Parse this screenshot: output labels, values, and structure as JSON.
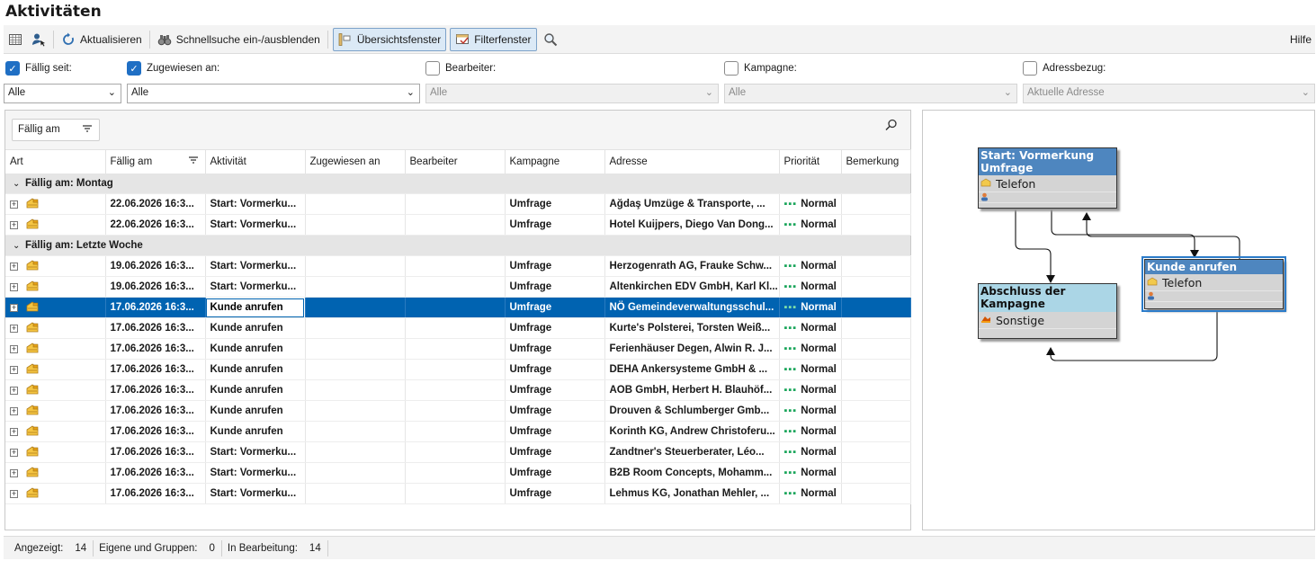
{
  "title": "Aktivitäten",
  "toolbar": {
    "refresh": "Aktualisieren",
    "quicksearch": "Schnellsuche ein-/ausblenden",
    "overview": "Übersichtsfenster",
    "filter": "Filterfenster",
    "help": "Hilfe"
  },
  "filters": [
    {
      "label": "Fällig seit:",
      "checked": true,
      "value": "Alle",
      "enabled": true
    },
    {
      "label": "Zugewiesen an:",
      "checked": true,
      "value": "Alle",
      "enabled": true
    },
    {
      "label": "Bearbeiter:",
      "checked": false,
      "value": "Alle",
      "enabled": false
    },
    {
      "label": "Kampagne:",
      "checked": false,
      "value": "Alle",
      "enabled": false
    },
    {
      "label": "Adressbezug:",
      "checked": false,
      "value": "Aktuelle Adresse",
      "enabled": false
    }
  ],
  "grid": {
    "group_chip": "Fällig am",
    "columns": [
      "Art",
      "Fällig am",
      "Aktivität",
      "Zugewiesen an",
      "Bearbeiter",
      "Kampagne",
      "Adresse",
      "Priorität",
      "Bemerkung"
    ],
    "groups": [
      {
        "label": "Fällig am: Montag",
        "rows": [
          {
            "due": "22.06.2026 16:3...",
            "activity": "Start: Vormerku...",
            "assigned": "",
            "editor": "",
            "campaign": "Umfrage",
            "address": "Ağdaş Umzüge & Transporte, ...",
            "priority": "Normal",
            "note": "",
            "selected": false
          },
          {
            "due": "22.06.2026 16:3...",
            "activity": "Start: Vormerku...",
            "assigned": "",
            "editor": "",
            "campaign": "Umfrage",
            "address": "Hotel Kuijpers, Diego Van Dong...",
            "priority": "Normal",
            "note": "",
            "selected": false
          }
        ]
      },
      {
        "label": "Fällig am: Letzte Woche",
        "rows": [
          {
            "due": "19.06.2026 16:3...",
            "activity": "Start: Vormerku...",
            "assigned": "",
            "editor": "",
            "campaign": "Umfrage",
            "address": "Herzogenrath AG, Frauke Schw...",
            "priority": "Normal",
            "note": "",
            "selected": false
          },
          {
            "due": "19.06.2026 16:3...",
            "activity": "Start: Vormerku...",
            "assigned": "",
            "editor": "",
            "campaign": "Umfrage",
            "address": "Altenkirchen EDV GmbH, Karl Kl...",
            "priority": "Normal",
            "note": "",
            "selected": false
          },
          {
            "due": "17.06.2026 16:3...",
            "activity": "Kunde anrufen",
            "assigned": "",
            "editor": "",
            "campaign": "Umfrage",
            "address": "NÖ Gemeindeverwaltungsschul...",
            "priority": "Normal",
            "note": "",
            "selected": true
          },
          {
            "due": "17.06.2026 16:3...",
            "activity": "Kunde anrufen",
            "assigned": "",
            "editor": "",
            "campaign": "Umfrage",
            "address": "Kurte's Polsterei, Torsten Weiß...",
            "priority": "Normal",
            "note": "",
            "selected": false
          },
          {
            "due": "17.06.2026 16:3...",
            "activity": "Kunde anrufen",
            "assigned": "",
            "editor": "",
            "campaign": "Umfrage",
            "address": "Ferienhäuser Degen, Alwin R. J...",
            "priority": "Normal",
            "note": "",
            "selected": false
          },
          {
            "due": "17.06.2026 16:3...",
            "activity": "Kunde anrufen",
            "assigned": "",
            "editor": "",
            "campaign": "Umfrage",
            "address": "DEHA Ankersysteme GmbH & ...",
            "priority": "Normal",
            "note": "",
            "selected": false
          },
          {
            "due": "17.06.2026 16:3...",
            "activity": "Kunde anrufen",
            "assigned": "",
            "editor": "",
            "campaign": "Umfrage",
            "address": "AOB GmbH, Herbert H. Blauhöf...",
            "priority": "Normal",
            "note": "",
            "selected": false
          },
          {
            "due": "17.06.2026 16:3...",
            "activity": "Kunde anrufen",
            "assigned": "",
            "editor": "",
            "campaign": "Umfrage",
            "address": "Drouven & Schlumberger Gmb...",
            "priority": "Normal",
            "note": "",
            "selected": false
          },
          {
            "due": "17.06.2026 16:3...",
            "activity": "Kunde anrufen",
            "assigned": "",
            "editor": "",
            "campaign": "Umfrage",
            "address": "Korinth KG, Andrew Christoferu...",
            "priority": "Normal",
            "note": "",
            "selected": false
          },
          {
            "due": "17.06.2026 16:3...",
            "activity": "Start: Vormerku...",
            "assigned": "",
            "editor": "",
            "campaign": "Umfrage",
            "address": "Zandtner's Steuerberater, Léo...",
            "priority": "Normal",
            "note": "",
            "selected": false
          },
          {
            "due": "17.06.2026 16:3...",
            "activity": "Start: Vormerku...",
            "assigned": "",
            "editor": "",
            "campaign": "Umfrage",
            "address": "B2B Room Concepts, Mohamm...",
            "priority": "Normal",
            "note": "",
            "selected": false
          },
          {
            "due": "17.06.2026 16:3...",
            "activity": "Start: Vormerku...",
            "assigned": "",
            "editor": "",
            "campaign": "Umfrage",
            "address": "Lehmus KG, Jonathan Mehler, ...",
            "priority": "Normal",
            "note": "",
            "selected": false
          }
        ]
      }
    ]
  },
  "diagram": {
    "nodes": [
      {
        "id": "start",
        "title": "Start: Vormerkung Umfrage",
        "type": "Telefon",
        "icon": "phone-icon",
        "style": "dark",
        "selected": false
      },
      {
        "id": "kunde",
        "title": "Kunde anrufen",
        "type": "Telefon",
        "icon": "phone-icon",
        "style": "dark",
        "selected": true
      },
      {
        "id": "abschluss",
        "title": "Abschluss der Kampagne",
        "type": "Sonstige",
        "icon": "misc-icon",
        "style": "light",
        "selected": false
      }
    ]
  },
  "status": {
    "shown_label": "Angezeigt:",
    "shown": "14",
    "own_label": "Eigene und Gruppen:",
    "own": "0",
    "editing_label": "In Bearbeitung:",
    "editing": "14"
  },
  "colors": {
    "selection": "#0063b1",
    "priority": "#19a55a",
    "node_header": "#4e86bf",
    "node_header_light": "#abd6e6"
  }
}
